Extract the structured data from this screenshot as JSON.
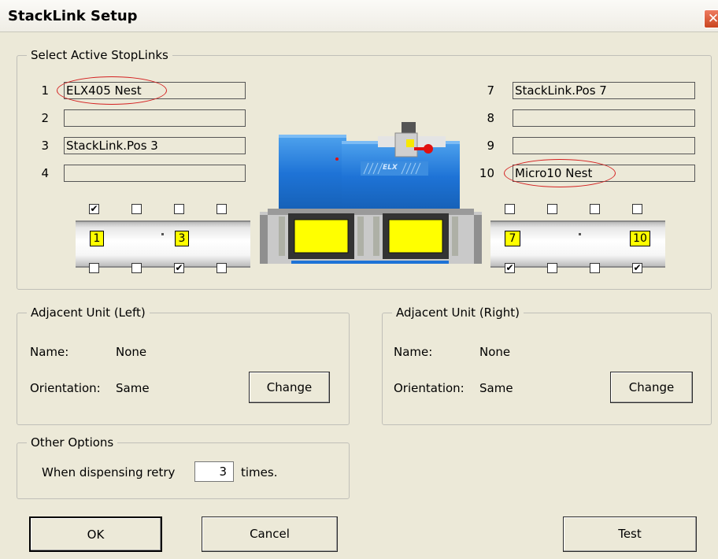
{
  "window": {
    "title": "StackLink Setup",
    "close_glyph": "✕"
  },
  "stoplinks": {
    "group_label": "Select Active StopLinks",
    "left": [
      {
        "num": "1",
        "value": "ELX405 Nest"
      },
      {
        "num": "2",
        "value": ""
      },
      {
        "num": "3",
        "value": "StackLink.Pos 3"
      },
      {
        "num": "4",
        "value": ""
      }
    ],
    "right": [
      {
        "num": "7",
        "value": "StackLink.Pos 7"
      },
      {
        "num": "8",
        "value": ""
      },
      {
        "num": "9",
        "value": ""
      },
      {
        "num": "10",
        "value": "Micro10 Nest"
      }
    ],
    "left_track": {
      "slot_start": "1",
      "slot_end": "3",
      "top_checks": [
        true,
        false,
        false,
        false
      ],
      "bottom_checks": [
        false,
        false,
        true,
        false
      ]
    },
    "right_track": {
      "slot_start": "7",
      "slot_end": "10",
      "top_checks": [
        false,
        false,
        false,
        false
      ],
      "bottom_checks": [
        true,
        false,
        false,
        true
      ]
    },
    "device_logo": "ELX",
    "highlight_color": "#d42020",
    "slot_color": "#ffff00",
    "device_color": "#1e73d6"
  },
  "adjacent_left": {
    "group_label": "Adjacent Unit (Left)",
    "name_label": "Name:",
    "name_value": "None",
    "orientation_label": "Orientation:",
    "orientation_value": "Same",
    "change_label": "Change"
  },
  "adjacent_right": {
    "group_label": "Adjacent Unit (Right)",
    "name_label": "Name:",
    "name_value": "None",
    "orientation_label": "Orientation:",
    "orientation_value": "Same",
    "change_label": "Change"
  },
  "other_options": {
    "group_label": "Other Options",
    "retry_prefix": "When dispensing retry",
    "retry_value": "3",
    "retry_suffix": "times."
  },
  "buttons": {
    "ok": "OK",
    "cancel": "Cancel",
    "test": "Test"
  },
  "icons": {
    "close": "close-icon",
    "checkmark": "checkmark-icon"
  }
}
